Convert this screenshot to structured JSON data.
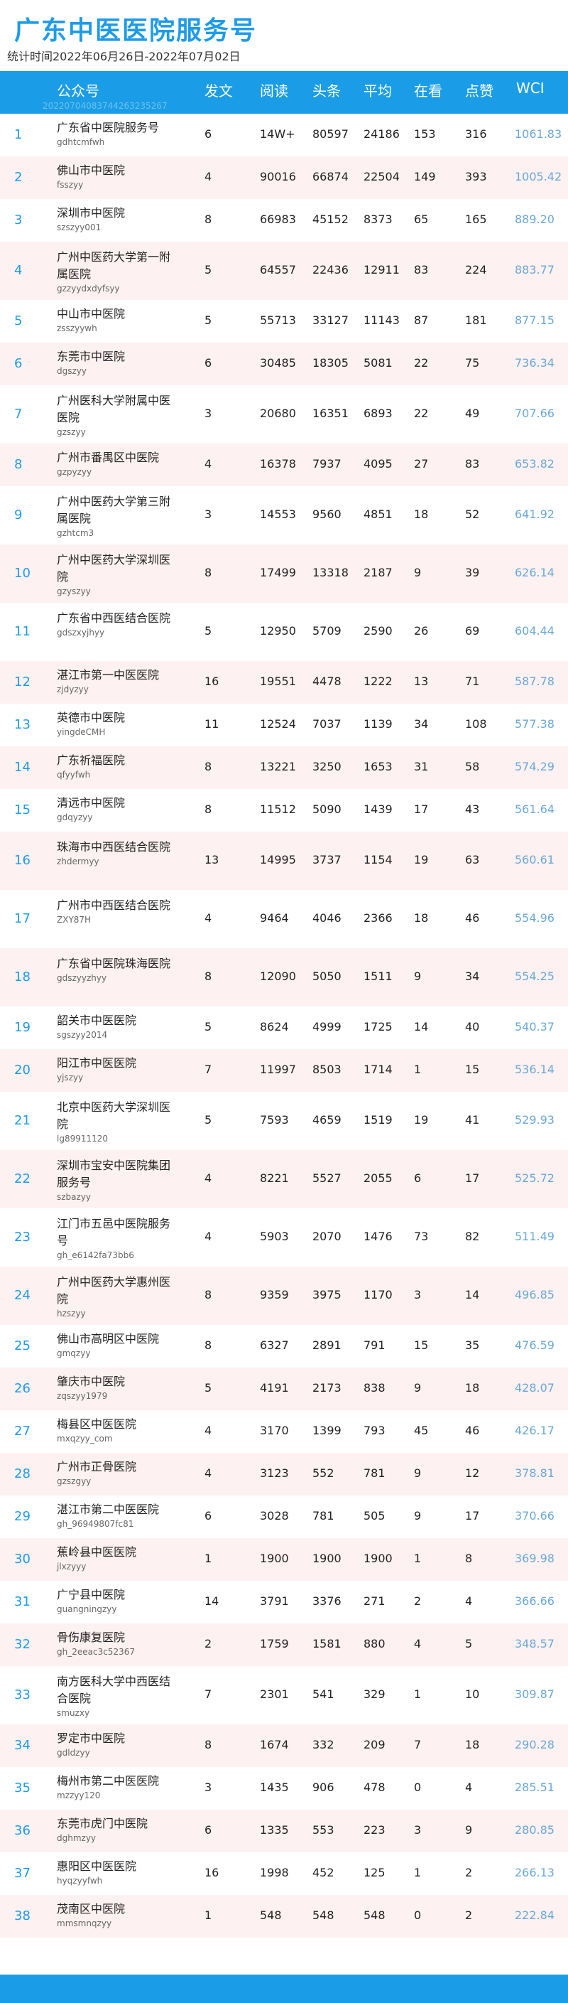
{
  "header": {
    "title": "广东中医医院服务号",
    "subtitle": "统计时间2022年06月26日-2022年07月02日"
  },
  "table": {
    "columns": [
      "公众号",
      "发文",
      "阅读",
      "头条",
      "平均",
      "在看",
      "点赞",
      "WCI"
    ],
    "watermark": "20220704083744263235267",
    "rows": [
      {
        "rank": "1",
        "name": "广东省中医院服务号",
        "account": "gdhtcmfwh",
        "posts": "6",
        "reads": "14W+",
        "top": "80597",
        "avg": "24186",
        "watch": "153",
        "likes": "316",
        "wci": "1061.83"
      },
      {
        "rank": "2",
        "name": "佛山市中医院",
        "account": "fsszyy",
        "posts": "4",
        "reads": "90016",
        "top": "66874",
        "avg": "22504",
        "watch": "149",
        "likes": "393",
        "wci": "1005.42"
      },
      {
        "rank": "3",
        "name": "深圳市中医院",
        "account": "szszyy001",
        "posts": "8",
        "reads": "66983",
        "top": "45152",
        "avg": "8373",
        "watch": "65",
        "likes": "165",
        "wci": "889.20"
      },
      {
        "rank": "4",
        "name": "广州中医药大学第一附属医院",
        "account": "gzzyydxdyfsyy",
        "posts": "5",
        "reads": "64557",
        "top": "22436",
        "avg": "12911",
        "watch": "83",
        "likes": "224",
        "wci": "883.77"
      },
      {
        "rank": "5",
        "name": "中山市中医院",
        "account": "zsszyywh",
        "posts": "5",
        "reads": "55713",
        "top": "33127",
        "avg": "11143",
        "watch": "87",
        "likes": "181",
        "wci": "877.15"
      },
      {
        "rank": "6",
        "name": "东莞市中医院",
        "account": "dgszyy",
        "posts": "6",
        "reads": "30485",
        "top": "18305",
        "avg": "5081",
        "watch": "22",
        "likes": "75",
        "wci": "736.34"
      },
      {
        "rank": "7",
        "name": "广州医科大学附属中医医院",
        "account": "gzszyy",
        "posts": "3",
        "reads": "20680",
        "top": "16351",
        "avg": "6893",
        "watch": "22",
        "likes": "49",
        "wci": "707.66"
      },
      {
        "rank": "8",
        "name": "广州市番禺区中医院",
        "account": "gzpyzyy",
        "posts": "4",
        "reads": "16378",
        "top": "7937",
        "avg": "4095",
        "watch": "27",
        "likes": "83",
        "wci": "653.82"
      },
      {
        "rank": "9",
        "name": "广州中医药大学第三附属医院",
        "account": "gzhtcm3",
        "posts": "3",
        "reads": "14553",
        "top": "9560",
        "avg": "4851",
        "watch": "18",
        "likes": "52",
        "wci": "641.92"
      },
      {
        "rank": "10",
        "name": "广州中医药大学深圳医院",
        "account": "gzyszyy",
        "posts": "8",
        "reads": "17499",
        "top": "13318",
        "avg": "2187",
        "watch": "9",
        "likes": "39",
        "wci": "626.14"
      },
      {
        "rank": "11",
        "name": "广东省中西医结合医院",
        "account": "gdszxyjhyy",
        "posts": "5",
        "reads": "12950",
        "top": "5709",
        "avg": "2590",
        "watch": "26",
        "likes": "69",
        "wci": "604.44"
      },
      {
        "rank": "12",
        "name": "湛江市第一中医医院",
        "account": "zjdyzyy",
        "posts": "16",
        "reads": "19551",
        "top": "4478",
        "avg": "1222",
        "watch": "13",
        "likes": "71",
        "wci": "587.78"
      },
      {
        "rank": "13",
        "name": "英德市中医院",
        "account": "yingdeCMH",
        "posts": "11",
        "reads": "12524",
        "top": "7037",
        "avg": "1139",
        "watch": "34",
        "likes": "108",
        "wci": "577.38"
      },
      {
        "rank": "14",
        "name": "广东祈福医院",
        "account": "qfyyfwh",
        "posts": "8",
        "reads": "13221",
        "top": "3250",
        "avg": "1653",
        "watch": "31",
        "likes": "58",
        "wci": "574.29"
      },
      {
        "rank": "15",
        "name": "清远市中医院",
        "account": "gdqyzyy",
        "posts": "8",
        "reads": "11512",
        "top": "5090",
        "avg": "1439",
        "watch": "17",
        "likes": "43",
        "wci": "561.64"
      },
      {
        "rank": "16",
        "name": "珠海市中西医结合医院",
        "account": "zhdermyy",
        "posts": "13",
        "reads": "14995",
        "top": "3737",
        "avg": "1154",
        "watch": "19",
        "likes": "63",
        "wci": "560.61"
      },
      {
        "rank": "17",
        "name": "广州市中西医结合医院",
        "account": "ZXY87H",
        "posts": "4",
        "reads": "9464",
        "top": "4046",
        "avg": "2366",
        "watch": "18",
        "likes": "46",
        "wci": "554.96"
      },
      {
        "rank": "18",
        "name": "广东省中医院珠海医院",
        "account": "gdszyyzhyy",
        "posts": "8",
        "reads": "12090",
        "top": "5050",
        "avg": "1511",
        "watch": "9",
        "likes": "34",
        "wci": "554.25"
      },
      {
        "rank": "19",
        "name": "韶关市中医医院",
        "account": "sgszyy2014",
        "posts": "5",
        "reads": "8624",
        "top": "4999",
        "avg": "1725",
        "watch": "14",
        "likes": "40",
        "wci": "540.37"
      },
      {
        "rank": "20",
        "name": "阳江市中医医院",
        "account": "yjszyy",
        "posts": "7",
        "reads": "11997",
        "top": "8503",
        "avg": "1714",
        "watch": "1",
        "likes": "15",
        "wci": "536.14"
      },
      {
        "rank": "21",
        "name": "北京中医药大学深圳医院",
        "account": "lg89911120",
        "posts": "5",
        "reads": "7593",
        "top": "4659",
        "avg": "1519",
        "watch": "19",
        "likes": "41",
        "wci": "529.93"
      },
      {
        "rank": "22",
        "name": "深圳市宝安中医院集团服务号",
        "account": "szbazyy",
        "posts": "4",
        "reads": "8221",
        "top": "5527",
        "avg": "2055",
        "watch": "6",
        "likes": "17",
        "wci": "525.72"
      },
      {
        "rank": "23",
        "name": "江门市五邑中医院服务号",
        "account": "gh_e6142fa73bb6",
        "posts": "4",
        "reads": "5903",
        "top": "2070",
        "avg": "1476",
        "watch": "73",
        "likes": "82",
        "wci": "511.49"
      },
      {
        "rank": "24",
        "name": "广州中医药大学惠州医院",
        "account": "hzszyy",
        "posts": "8",
        "reads": "9359",
        "top": "3975",
        "avg": "1170",
        "watch": "3",
        "likes": "14",
        "wci": "496.85"
      },
      {
        "rank": "25",
        "name": "佛山市高明区中医院",
        "account": "gmqzyy",
        "posts": "8",
        "reads": "6327",
        "top": "2891",
        "avg": "791",
        "watch": "15",
        "likes": "35",
        "wci": "476.59"
      },
      {
        "rank": "26",
        "name": "肇庆市中医院",
        "account": "zqszyy1979",
        "posts": "5",
        "reads": "4191",
        "top": "2173",
        "avg": "838",
        "watch": "9",
        "likes": "18",
        "wci": "428.07"
      },
      {
        "rank": "27",
        "name": "梅县区中医医院",
        "account": "mxqzyy_com",
        "posts": "4",
        "reads": "3170",
        "top": "1399",
        "avg": "793",
        "watch": "45",
        "likes": "46",
        "wci": "426.17"
      },
      {
        "rank": "28",
        "name": "广州市正骨医院",
        "account": "gzszgyy",
        "posts": "4",
        "reads": "3123",
        "top": "552",
        "avg": "781",
        "watch": "9",
        "likes": "12",
        "wci": "378.81"
      },
      {
        "rank": "29",
        "name": "湛江市第二中医医院",
        "account": "gh_96949807fc81",
        "posts": "6",
        "reads": "3028",
        "top": "781",
        "avg": "505",
        "watch": "9",
        "likes": "17",
        "wci": "370.66"
      },
      {
        "rank": "30",
        "name": "蕉岭县中医医院",
        "account": "jlxzyyy",
        "posts": "1",
        "reads": "1900",
        "top": "1900",
        "avg": "1900",
        "watch": "1",
        "likes": "8",
        "wci": "369.98"
      },
      {
        "rank": "31",
        "name": "广宁县中医院",
        "account": "guangningzyy",
        "posts": "14",
        "reads": "3791",
        "top": "3376",
        "avg": "271",
        "watch": "2",
        "likes": "4",
        "wci": "366.66"
      },
      {
        "rank": "32",
        "name": "骨伤康复医院",
        "account": "gh_2eeac3c52367",
        "posts": "2",
        "reads": "1759",
        "top": "1581",
        "avg": "880",
        "watch": "4",
        "likes": "5",
        "wci": "348.57"
      },
      {
        "rank": "33",
        "name": "南方医科大学中西医结合医院",
        "account": "smuzxy",
        "posts": "7",
        "reads": "2301",
        "top": "541",
        "avg": "329",
        "watch": "1",
        "likes": "10",
        "wci": "309.87"
      },
      {
        "rank": "34",
        "name": "罗定市中医院",
        "account": "gdldzyy",
        "posts": "8",
        "reads": "1674",
        "top": "332",
        "avg": "209",
        "watch": "7",
        "likes": "18",
        "wci": "290.28"
      },
      {
        "rank": "35",
        "name": "梅州市第二中医医院",
        "account": "mzzyy120",
        "posts": "3",
        "reads": "1435",
        "top": "906",
        "avg": "478",
        "watch": "0",
        "likes": "4",
        "wci": "285.51"
      },
      {
        "rank": "36",
        "name": "东莞市虎门中医院",
        "account": "dghmzyy",
        "posts": "6",
        "reads": "1335",
        "top": "553",
        "avg": "223",
        "watch": "3",
        "likes": "9",
        "wci": "280.85"
      },
      {
        "rank": "37",
        "name": "惠阳区中医医院",
        "account": "hyqzyyfwh",
        "posts": "16",
        "reads": "1998",
        "top": "452",
        "avg": "125",
        "watch": "1",
        "likes": "2",
        "wci": "266.13"
      },
      {
        "rank": "38",
        "name": "茂南区中医院",
        "account": "mmsmnqzyy",
        "posts": "1",
        "reads": "548",
        "top": "548",
        "avg": "548",
        "watch": "0",
        "likes": "2",
        "wci": "222.84"
      }
    ]
  }
}
